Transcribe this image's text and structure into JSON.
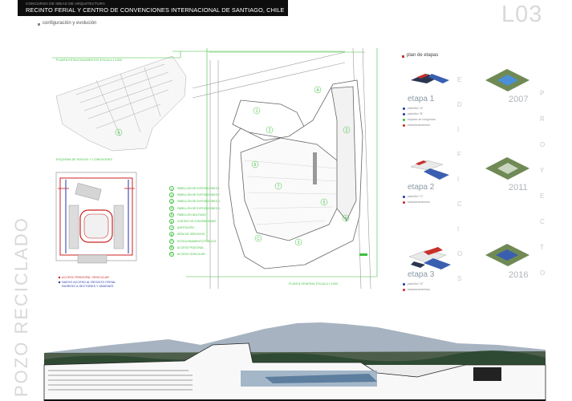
{
  "header": {
    "contest": "CONCURSO DE IDEAS DE ARQUITECTURA",
    "title": "RECINTO FERIAL Y CENTRO DE CONVENCIONES INTERNACIONAL DE SANTIAGO, CHILE",
    "sheet_code": "L03"
  },
  "subtitle": "configuración y evolución",
  "side_title": "POZO RECICLADO",
  "site_plan": {
    "parking_title": "PLANTA ESTACIONAMIENTOS ESCALA 1:1000",
    "general_title": "PLANTA GENERAL ESCALA 1:1000",
    "corner_title": "ESQUEMA DE RUIDOS Y CONEXIONES",
    "corner_note_1": "ACCESO PRINCIPAL VEHICULAR",
    "corner_note_2": "NUEVO ACCESO AL RECINTO FERIAL",
    "corner_note_3": "INGRESO A SECTORES Y ANDENES",
    "legend": [
      {
        "key": "1",
        "text": "PABELLÓN DE EXPOSICIONES 1"
      },
      {
        "key": "2",
        "text": "PABELLÓN DE EXPOSICIONES 2"
      },
      {
        "key": "3",
        "text": "PABELLÓN DE EXPOSICIONES 3"
      },
      {
        "key": "4",
        "text": "PABELLÓN DE EXPOSICIONES 4"
      },
      {
        "key": "5",
        "text": "PABELLÓN MULTIUSO"
      },
      {
        "key": "6",
        "text": "CENTRO DE CONVENCIONES"
      },
      {
        "key": "7",
        "text": "ANFITEATRO"
      },
      {
        "key": "8",
        "text": "ÁREA DE SERVICIOS"
      },
      {
        "key": "A",
        "text": "ESTACIONAMIENTO PÚBLICO"
      },
      {
        "key": "B",
        "text": "ACCESO PEATONAL"
      },
      {
        "key": "C",
        "text": "ACCESO VEHICULAR"
      }
    ]
  },
  "stages": {
    "title": "plan de etapas",
    "items": [
      {
        "label": "etapa 1",
        "year": "2007",
        "legend": [
          {
            "color": "#2233aa",
            "text": "pabellón \"A\""
          },
          {
            "color": "#2233aa",
            "text": "pabellón \"B\""
          },
          {
            "color": "#33bb33",
            "text": "espacio de congresos"
          },
          {
            "color": "#cc2222",
            "text": "estacionamientos"
          }
        ]
      },
      {
        "label": "etapa 2",
        "year": "2011",
        "legend": [
          {
            "color": "#2233aa",
            "text": "pabellón \"C\""
          },
          {
            "color": "#cc2222",
            "text": "estacionamientos"
          }
        ]
      },
      {
        "label": "etapa 3",
        "year": "2016",
        "legend": [
          {
            "color": "#2233aa",
            "text": "pabellón \"D\""
          },
          {
            "color": "#cc2222",
            "text": "estacionamientos"
          }
        ]
      }
    ],
    "vertical_word_1": "EDIFICIOS",
    "vertical_word_2": "PROYECTO"
  },
  "colors": {
    "plan_line": "#3fbf3f",
    "building_line": "#777777",
    "header_bg": "#0d0d0d"
  }
}
